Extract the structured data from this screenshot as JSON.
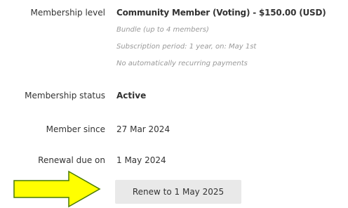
{
  "membership": {
    "level_label": "Membership level",
    "level_value": "Community Member (Voting) - $150.00 (USD)",
    "level_notes": [
      "Bundle (up to 4 members)",
      "Subscription period: 1 year, on: May 1st",
      "No automatically recurring payments"
    ],
    "status_label": "Membership status",
    "status_value": "Active",
    "since_label": "Member since",
    "since_value": "27 Mar 2024",
    "renewal_label": "Renewal due on",
    "renewal_value": "1 May 2024",
    "renew_button_label": "Renew to 1 May 2025"
  },
  "colors": {
    "arrow_fill": "#ffff00",
    "arrow_stroke": "#4a7a00",
    "button_bg": "#e9e9e9",
    "note_text": "#999999"
  },
  "icons": {
    "pointer": "arrow-right-icon"
  }
}
